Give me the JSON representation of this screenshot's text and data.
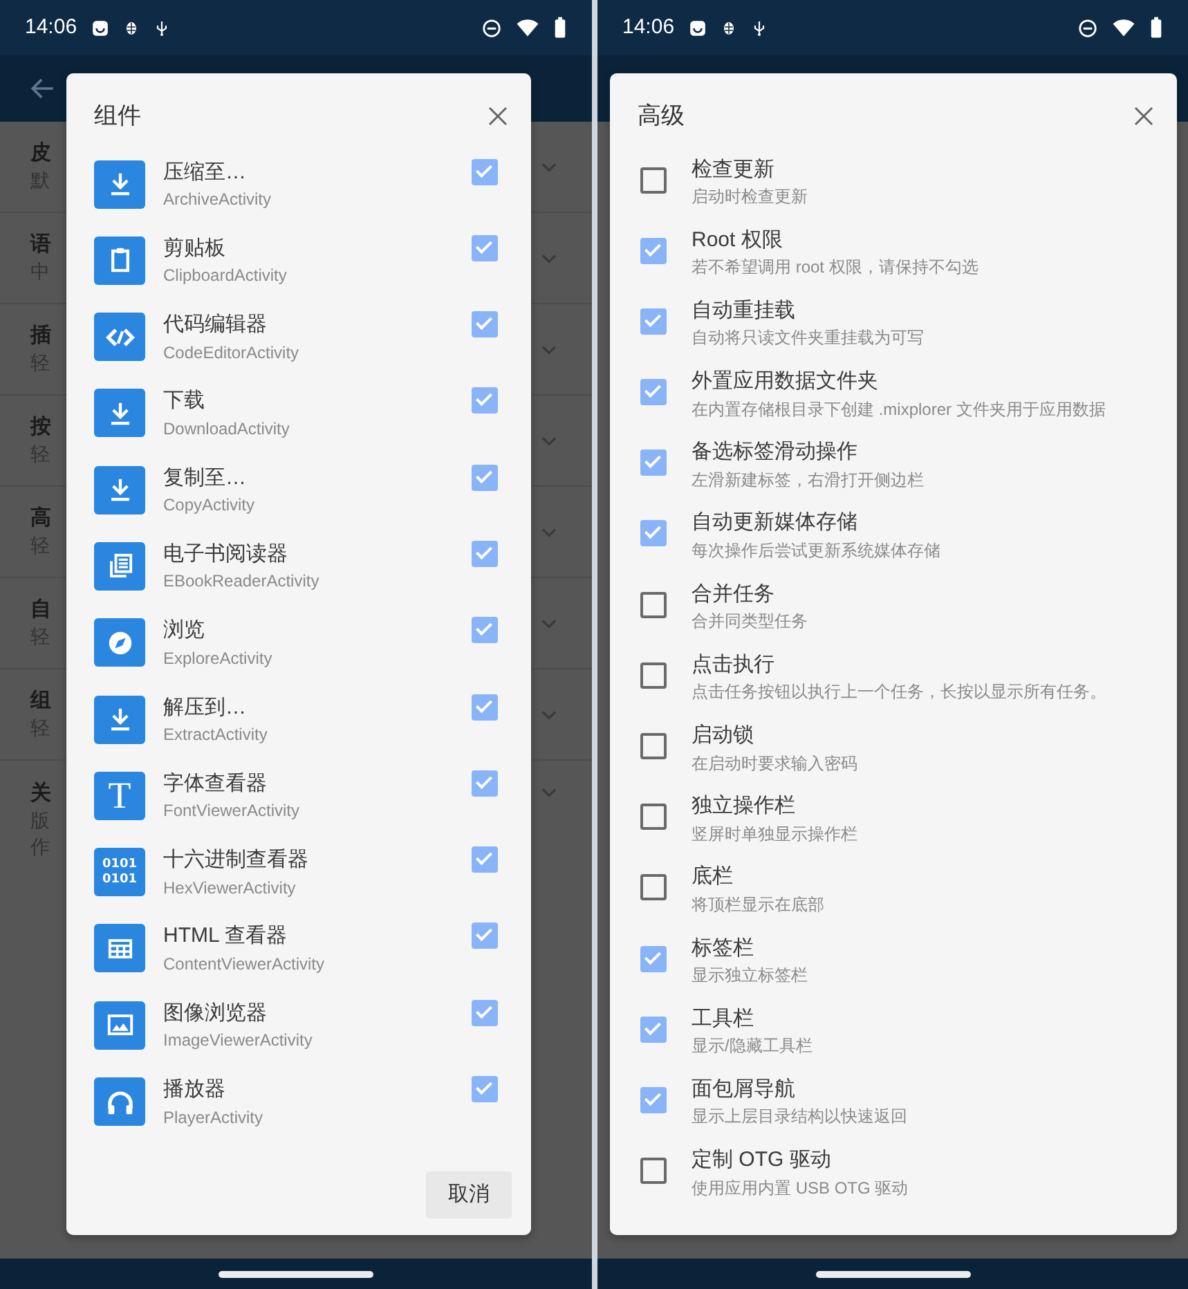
{
  "screens": [
    {
      "kind": "components",
      "status_bar": {
        "time": "14:06"
      },
      "background_rows": [
        {
          "lines": [
            "皮",
            "默"
          ]
        },
        {
          "lines": [
            "语",
            "中"
          ]
        },
        {
          "lines": [
            "插",
            "轻"
          ]
        },
        {
          "lines": [
            "按",
            "轻"
          ]
        },
        {
          "lines": [
            "高",
            "轻"
          ]
        },
        {
          "lines": [
            "自",
            "轻"
          ]
        },
        {
          "lines": [
            "组",
            "轻"
          ]
        },
        {
          "lines": [
            "关",
            "版",
            "作"
          ]
        }
      ],
      "dialog": {
        "title": "组件",
        "buttons": [
          "取消"
        ],
        "items": [
          {
            "kind": "download",
            "title": "压缩至…",
            "subtitle": "ArchiveActivity",
            "checked": true
          },
          {
            "kind": "clipboard",
            "title": "剪贴板",
            "subtitle": "ClipboardActivity",
            "checked": true
          },
          {
            "kind": "code",
            "title": "代码编辑器",
            "subtitle": "CodeEditorActivity",
            "checked": true
          },
          {
            "kind": "download",
            "title": "下载",
            "subtitle": "DownloadActivity",
            "checked": true
          },
          {
            "kind": "download",
            "title": "复制至…",
            "subtitle": "CopyActivity",
            "checked": true
          },
          {
            "kind": "book",
            "title": "电子书阅读器",
            "subtitle": "EBookReaderActivity",
            "checked": true
          },
          {
            "kind": "compass",
            "title": "浏览",
            "subtitle": "ExploreActivity",
            "checked": true
          },
          {
            "kind": "download",
            "title": "解压到…",
            "subtitle": "ExtractActivity",
            "checked": true
          },
          {
            "kind": "glyph",
            "icon_lines": [
              "T"
            ],
            "title": "字体查看器",
            "subtitle": "FontViewerActivity",
            "checked": true
          },
          {
            "kind": "binary",
            "icon_lines": [
              "0101",
              "0101"
            ],
            "title": "十六进制查看器",
            "subtitle": "HexViewerActivity",
            "checked": true
          },
          {
            "kind": "table",
            "title": "HTML 查看器",
            "subtitle": "ContentViewerActivity",
            "checked": true
          },
          {
            "kind": "image",
            "title": "图像浏览器",
            "subtitle": "ImageViewerActivity",
            "checked": true
          },
          {
            "kind": "headphones",
            "title": "播放器",
            "subtitle": "PlayerActivity",
            "checked": true
          }
        ]
      }
    },
    {
      "kind": "options",
      "status_bar": {
        "time": "14:06"
      },
      "dialog": {
        "title": "高级",
        "items": [
          {
            "title": "检查更新",
            "subtitle": "启动时检查更新",
            "checked": false
          },
          {
            "title": "Root 权限",
            "subtitle": "若不希望调用 root 权限，请保持不勾选",
            "checked": true
          },
          {
            "title": "自动重挂载",
            "subtitle": "自动将只读文件夹重挂载为可写",
            "checked": true
          },
          {
            "title": "外置应用数据文件夹",
            "subtitle": "在内置存储根目录下创建 .mixplorer 文件夹用于应用数据",
            "checked": true
          },
          {
            "title": "备选标签滑动操作",
            "subtitle": "左滑新建标签，右滑打开侧边栏",
            "checked": true
          },
          {
            "title": "自动更新媒体存储",
            "subtitle": "每次操作后尝试更新系统媒体存储",
            "checked": true
          },
          {
            "title": "合并任务",
            "subtitle": "合并同类型任务",
            "checked": false
          },
          {
            "title": "点击执行",
            "subtitle": "点击任务按钮以执行上一个任务，长按以显示所有任务。",
            "checked": false
          },
          {
            "title": "启动锁",
            "subtitle": "在启动时要求输入密码",
            "checked": false
          },
          {
            "title": "独立操作栏",
            "subtitle": "竖屏时单独显示操作栏",
            "checked": false
          },
          {
            "title": "底栏",
            "subtitle": "将顶栏显示在底部",
            "checked": false
          },
          {
            "title": "标签栏",
            "subtitle": "显示独立标签栏",
            "checked": true
          },
          {
            "title": "工具栏",
            "subtitle": "显示/隐藏工具栏",
            "checked": true
          },
          {
            "title": "面包屑导航",
            "subtitle": "显示上层目录结构以快速返回",
            "checked": true
          },
          {
            "title": "定制 OTG 驱动",
            "subtitle": "使用应用内置 USB OTG 驱动",
            "checked": false
          }
        ]
      }
    }
  ]
}
